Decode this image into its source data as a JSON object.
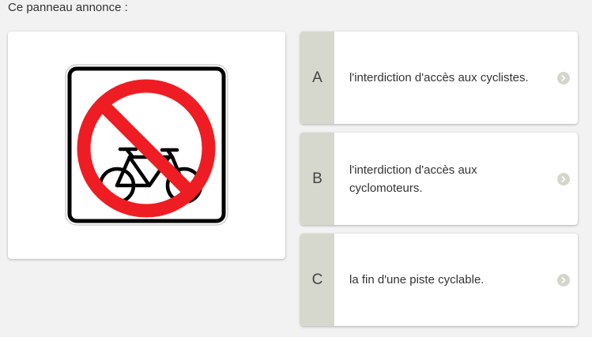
{
  "question": "Ce panneau annonce :",
  "sign": {
    "icon": "no-bicycles-sign",
    "ring_color": "#ee1d23",
    "frame_color": "#000000"
  },
  "answers": [
    {
      "letter": "A",
      "text": "l'interdiction d'accès aux cyclistes."
    },
    {
      "letter": "B",
      "text": "l'interdiction d'accès aux cyclomoteurs."
    },
    {
      "letter": "C",
      "text": "la fin d'une piste cyclable."
    }
  ],
  "colors": {
    "letter_bg": "#d6d8ce",
    "chevron_bg": "#d4d6cc",
    "page_bg": "#f2f2f2"
  }
}
